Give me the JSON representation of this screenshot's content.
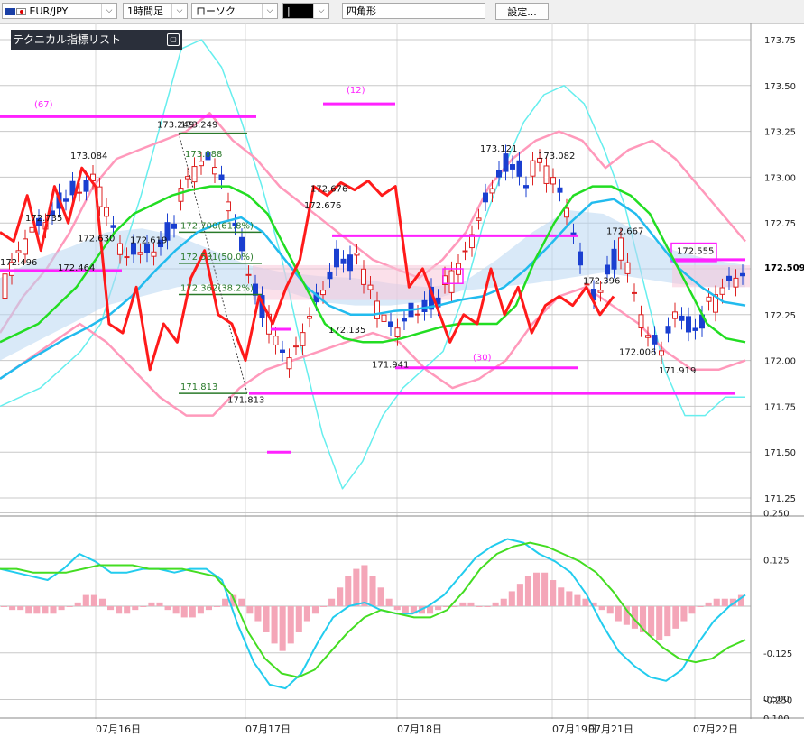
{
  "toolbar": {
    "symbol": "EUR/JPY",
    "timeframe": "1時間足",
    "chart_type": "ローソク",
    "draw_tool_icon": "|",
    "draw_shape": "四角形",
    "settings_label": "設定..."
  },
  "indicator_panel": {
    "title": "テクニカル指標リスト"
  },
  "chart_data": [
    {
      "type": "line",
      "title": "",
      "y_axis_ticks": [
        "173.75",
        "173.50",
        "173.25",
        "173.00",
        "172.75",
        "172.50",
        "172.25",
        "172.00",
        "171.75",
        "171.50",
        "171.25"
      ],
      "ylim": [
        171.2,
        173.8
      ],
      "x_axis_ticks": [
        "07月16日",
        "07月17日",
        "07月18日",
        "07月19日",
        "07月21日",
        "07月22日"
      ],
      "current_price": "172.509",
      "annotations": [
        "173.084",
        "172.735",
        "172.630",
        "172.619",
        "172.496",
        "172.464",
        "173.249",
        "173.249",
        "173.088",
        "172.700(61.8%)",
        "172.531(50.0%)",
        "172.362(38.2%)",
        "171.813",
        "171.813",
        "172.676",
        "172.676",
        "172.135",
        "171.941",
        "173.121",
        "173.082",
        "172.667",
        "172.396",
        "172.006",
        "171.919",
        "172.555",
        "(67)",
        "(12)",
        "(30)"
      ],
      "series": [
        {
          "color": "#ff1a1a",
          "values": [
            172.7,
            172.65,
            172.9,
            172.6,
            172.95,
            172.75,
            173.05,
            172.95,
            172.2,
            172.15,
            172.4,
            171.95,
            172.2,
            172.1,
            172.45,
            172.6,
            172.25,
            172.2,
            172.0,
            172.35,
            172.2,
            172.4,
            172.55,
            172.95,
            172.9,
            172.97,
            172.93,
            172.98,
            172.9,
            172.95,
            172.4,
            172.5,
            172.3,
            172.1,
            172.25,
            172.2,
            172.5,
            172.25,
            172.4,
            172.15,
            172.3,
            172.35,
            172.3,
            172.4,
            172.25,
            172.35
          ]
        },
        {
          "color": "#22dd22",
          "values": [
            172.1,
            172.15,
            172.2,
            172.3,
            172.4,
            172.55,
            172.7,
            172.8,
            172.85,
            172.9,
            172.93,
            172.95,
            172.95,
            172.9,
            172.8,
            172.6,
            172.4,
            172.2,
            172.12,
            172.1,
            172.1,
            172.12,
            172.15,
            172.18,
            172.2,
            172.2,
            172.2,
            172.3,
            172.55,
            172.75,
            172.9,
            172.95,
            172.95,
            172.9,
            172.8,
            172.6,
            172.4,
            172.2,
            172.12,
            172.1
          ]
        },
        {
          "color": "#22bbee",
          "values": [
            171.9,
            171.98,
            172.05,
            172.12,
            172.18,
            172.25,
            172.35,
            172.48,
            172.6,
            172.7,
            172.75,
            172.78,
            172.7,
            172.55,
            172.4,
            172.3,
            172.25,
            172.25,
            172.27,
            172.28,
            172.3,
            172.33,
            172.35,
            172.4,
            172.5,
            172.62,
            172.75,
            172.86,
            172.88,
            172.8,
            172.65,
            172.5,
            172.4,
            172.32,
            172.3
          ]
        },
        {
          "color": "#ff99bb",
          "values": [
            172.15,
            172.35,
            172.5,
            172.7,
            172.95,
            173.1,
            173.15,
            173.2,
            173.25,
            173.35,
            173.2,
            173.1,
            172.95,
            172.85,
            172.75,
            172.65,
            172.55,
            172.5,
            172.45,
            172.55,
            172.7,
            172.95,
            173.1,
            173.2,
            173.25,
            173.2,
            173.05,
            173.15,
            173.2,
            173.1,
            172.95,
            172.8,
            172.65
          ]
        },
        {
          "color": "#ff99bb",
          "values": [
            171.9,
            172.0,
            172.1,
            172.2,
            172.1,
            171.95,
            171.8,
            171.7,
            171.7,
            171.85,
            171.95,
            172.0,
            172.05,
            172.1,
            172.15,
            172.1,
            171.95,
            171.85,
            171.9,
            172.0,
            172.2,
            172.35,
            172.4,
            172.3,
            172.2,
            172.05,
            171.95,
            171.95,
            172.0
          ]
        },
        {
          "color": "#66eeee",
          "values": [
            171.75,
            171.8,
            171.85,
            171.95,
            172.05,
            172.2,
            172.55,
            172.9,
            173.3,
            173.7,
            173.75,
            173.6,
            173.3,
            172.95,
            172.55,
            172.05,
            171.6,
            171.3,
            171.45,
            171.7,
            171.85,
            171.95,
            172.05,
            172.35,
            172.75,
            173.05,
            173.3,
            173.45,
            173.5,
            173.4,
            173.15,
            172.85,
            172.4,
            171.95,
            171.7,
            171.7,
            171.8,
            171.8
          ]
        }
      ]
    },
    {
      "type": "bar",
      "title": "",
      "y_axis_ticks": [
        "0.250",
        "0.125",
        "-0.125",
        "-0.250"
      ],
      "ylim": [
        -0.27,
        0.26
      ],
      "values": [
        0.0,
        -0.01,
        -0.01,
        -0.02,
        -0.02,
        -0.02,
        -0.02,
        -0.01,
        0.0,
        0.01,
        0.03,
        0.03,
        0.02,
        -0.01,
        -0.02,
        -0.02,
        -0.01,
        0.0,
        0.01,
        0.01,
        -0.01,
        -0.02,
        -0.03,
        -0.03,
        -0.02,
        -0.01,
        0.0,
        0.02,
        0.03,
        0.02,
        -0.02,
        -0.04,
        -0.07,
        -0.1,
        -0.12,
        -0.1,
        -0.07,
        -0.04,
        -0.02,
        0.0,
        0.02,
        0.05,
        0.08,
        0.1,
        0.11,
        0.08,
        0.05,
        0.02,
        -0.01,
        -0.02,
        -0.02,
        -0.02,
        -0.02,
        -0.01,
        0.0,
        0.0,
        0.01,
        0.01,
        0.0,
        0.0,
        0.01,
        0.02,
        0.04,
        0.06,
        0.08,
        0.09,
        0.09,
        0.07,
        0.05,
        0.04,
        0.03,
        0.02,
        0.01,
        -0.01,
        -0.02,
        -0.04,
        -0.05,
        -0.06,
        -0.07,
        -0.08,
        -0.09,
        -0.08,
        -0.06,
        -0.04,
        -0.02,
        0.0,
        0.01,
        0.02,
        0.02,
        0.02,
        0.03
      ],
      "series": [
        {
          "color": "#22ccee",
          "values": [
            0.1,
            0.09,
            0.08,
            0.07,
            0.1,
            0.14,
            0.12,
            0.09,
            0.09,
            0.1,
            0.1,
            0.09,
            0.1,
            0.1,
            0.07,
            -0.05,
            -0.15,
            -0.21,
            -0.22,
            -0.18,
            -0.1,
            -0.03,
            0.0,
            0.01,
            -0.01,
            -0.02,
            -0.02,
            0.0,
            0.03,
            0.08,
            0.13,
            0.16,
            0.18,
            0.17,
            0.14,
            0.12,
            0.09,
            0.03,
            -0.05,
            -0.12,
            -0.16,
            -0.19,
            -0.2,
            -0.17,
            -0.1,
            -0.04,
            0.0,
            0.03
          ]
        },
        {
          "color": "#44dd22",
          "values": [
            0.1,
            0.1,
            0.09,
            0.09,
            0.09,
            0.1,
            0.11,
            0.11,
            0.11,
            0.1,
            0.1,
            0.1,
            0.09,
            0.08,
            0.03,
            -0.07,
            -0.14,
            -0.18,
            -0.19,
            -0.17,
            -0.12,
            -0.07,
            -0.03,
            -0.01,
            -0.02,
            -0.03,
            -0.03,
            -0.01,
            0.04,
            0.1,
            0.14,
            0.16,
            0.17,
            0.16,
            0.14,
            0.12,
            0.09,
            0.04,
            -0.02,
            -0.07,
            -0.11,
            -0.14,
            -0.15,
            -0.14,
            -0.11,
            -0.09
          ]
        }
      ]
    }
  ]
}
